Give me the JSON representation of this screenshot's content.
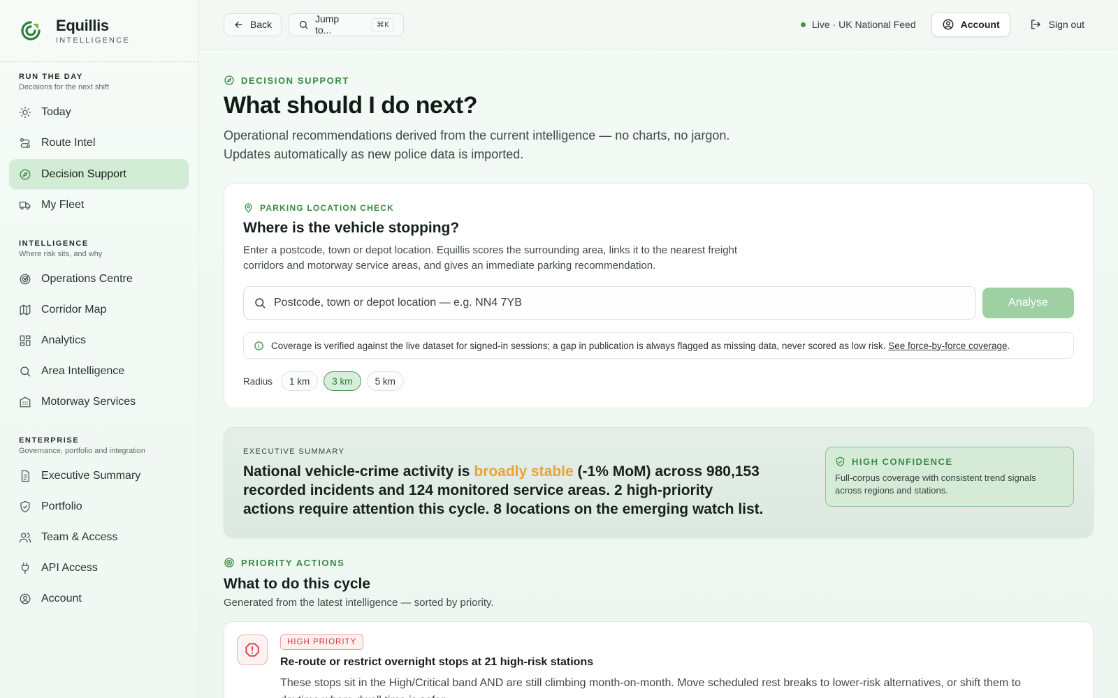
{
  "brand": {
    "name": "Equillis",
    "sub": "INTELLIGENCE"
  },
  "nav": {
    "sections": [
      {
        "title": "RUN THE DAY",
        "subtitle": "Decisions for the next shift",
        "items": [
          {
            "label": "Today"
          },
          {
            "label": "Route Intel"
          },
          {
            "label": "Decision Support",
            "active": true
          },
          {
            "label": "My Fleet"
          }
        ]
      },
      {
        "title": "INTELLIGENCE",
        "subtitle": "Where risk sits, and why",
        "items": [
          {
            "label": "Operations Centre"
          },
          {
            "label": "Corridor Map"
          },
          {
            "label": "Analytics"
          },
          {
            "label": "Area Intelligence"
          },
          {
            "label": "Motorway Services"
          }
        ]
      },
      {
        "title": "ENTERPRISE",
        "subtitle": "Governance, portfolio and integration",
        "items": [
          {
            "label": "Executive Summary"
          },
          {
            "label": "Portfolio"
          },
          {
            "label": "Team & Access"
          },
          {
            "label": "API Access"
          },
          {
            "label": "Account"
          }
        ]
      }
    ]
  },
  "topbar": {
    "back": "Back",
    "jump": "Jump to...",
    "shortcut": "⌘K",
    "live": "Live · UK National Feed",
    "account": "Account",
    "signout": "Sign out"
  },
  "page": {
    "eyebrow": "DECISION SUPPORT",
    "title": "What should I do next?",
    "lede": "Operational recommendations derived from the current intelligence — no charts, no jargon. Updates automatically as new police data is imported."
  },
  "parking": {
    "eyebrow": "PARKING LOCATION CHECK",
    "title": "Where is the vehicle stopping?",
    "desc": "Enter a postcode, town or depot location. Equillis scores the surrounding area, links it to the nearest freight corridors and motorway service areas, and gives an immediate parking recommendation.",
    "placeholder": "Postcode, town or depot location — e.g. NN4 7YB",
    "analyse": "Analyse",
    "coverage_text": "Coverage is verified against the live dataset for signed-in sessions; a gap in publication is always flagged as missing data, never scored as low risk.",
    "coverage_link": "See force-by-force coverage",
    "coverage_end": ".",
    "radius_label": "Radius",
    "radius_options": [
      "1 km",
      "3 km",
      "5 km"
    ],
    "radius_selected": "3 km"
  },
  "exec": {
    "label": "EXECUTIVE SUMMARY",
    "pre": "National vehicle-crime activity is ",
    "highlight": "broadly stable",
    "post": " (-1% MoM) across 980,153 recorded incidents and 124 monitored service areas. 2 high-priority actions require attention this cycle. 8 locations on the emerging watch list.",
    "highlight_color": "#e8a33a",
    "confidence_title": "HIGH CONFIDENCE",
    "confidence_text": "Full-corpus coverage with consistent trend signals across regions and stations."
  },
  "priority": {
    "eyebrow": "PRIORITY ACTIONS",
    "title": "What to do this cycle",
    "sub": "Generated from the latest intelligence — sorted by priority.",
    "actions": [
      {
        "badge": "HIGH PRIORITY",
        "title": "Re-route or restrict overnight stops at 21 high-risk stations",
        "text": "These stops sit in the High/Critical band AND are still climbing month-on-month. Move scheduled rest breaks to lower-risk alternatives, or shift them to daytime where dwell time is safer."
      }
    ]
  },
  "colors": {
    "accent": "#3a8a44",
    "active_bg": "#d2ecd5",
    "danger": "#d83a3a"
  }
}
